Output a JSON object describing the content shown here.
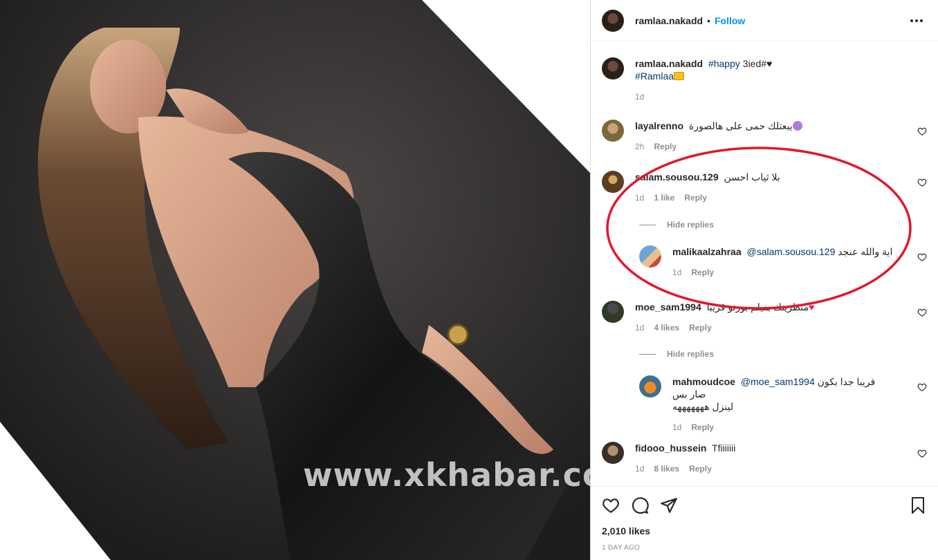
{
  "post": {
    "username": "ramlaa.nakadd",
    "follow_label": "Follow",
    "caption": {
      "username": "ramlaa.nakadd",
      "hashtag_happy": "#happy",
      "text_3ied": "3ied#",
      "hashtag_ramlaa": "#Ramlaa",
      "time": "1d"
    }
  },
  "comments": [
    {
      "username": "layalrenno",
      "text": "يبعتلك حمى على هالصورة",
      "time": "2h",
      "likes": "",
      "reply": "Reply"
    },
    {
      "username": "salam.sousou.129",
      "text": "بلا ثياب احسن",
      "time": "1d",
      "likes": "1 like",
      "reply": "Reply",
      "hide_replies": "Hide replies",
      "replies": [
        {
          "username": "malikaalzahraa",
          "mention": "@salam.sousou.129",
          "text": "اية والله عنجد",
          "time": "1d",
          "reply": "Reply"
        }
      ]
    },
    {
      "username": "moe_sam1994",
      "text": "منطرينك بفيلم بورنو قريبا",
      "time": "1d",
      "likes": "4 likes",
      "reply": "Reply",
      "hide_replies": "Hide replies",
      "replies": [
        {
          "username": "mahmoudcoe",
          "mention": "@moe_sam1994",
          "text_line1": "قريبا جدا بكون صار بس",
          "text_line2": "لينزل هههههههه",
          "time": "1d",
          "reply": "Reply"
        }
      ]
    },
    {
      "username": "fidooo_hussein",
      "text": "Tfiiiiiii",
      "time": "1d",
      "likes": "8 likes",
      "reply": "Reply"
    }
  ],
  "footer": {
    "likes": "2,010 likes",
    "date": "1 DAY AGO"
  },
  "watermark": "www.xkhabar.com",
  "colors": {
    "link_blue": "#0095f6",
    "hashtag": "#00376b",
    "annotation_red": "#e0192c",
    "secondary_text": "#8e8e8e"
  },
  "icons": [
    "more-options-icon",
    "heart-icon",
    "comment-icon",
    "share-icon",
    "save-icon"
  ]
}
